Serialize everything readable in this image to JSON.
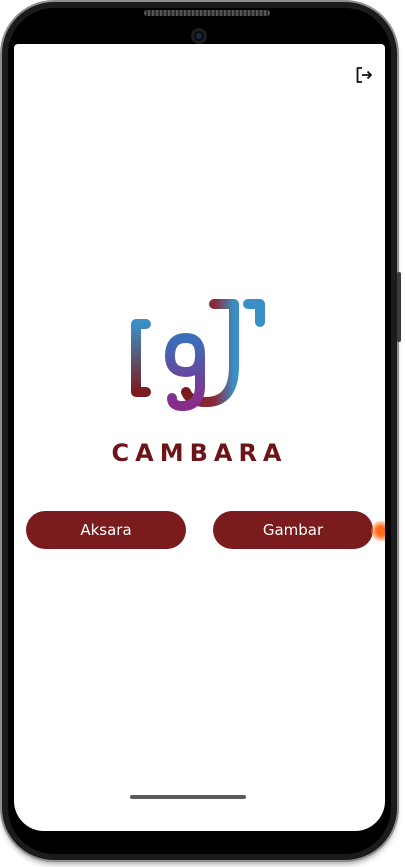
{
  "app": {
    "brand_name": "CAMBARA"
  },
  "actions": {
    "aksara_label": "Aksara",
    "gambar_label": "Gambar"
  },
  "icons": {
    "logout": "logout-icon",
    "logo": "cambara-logo"
  },
  "colors": {
    "primary": "#7a1b1e",
    "brand_text": "#6b1518",
    "logo_blue": "#3a8fc4",
    "logo_purple": "#7a2a8a",
    "touch_ripple": "#ff6a1a"
  }
}
